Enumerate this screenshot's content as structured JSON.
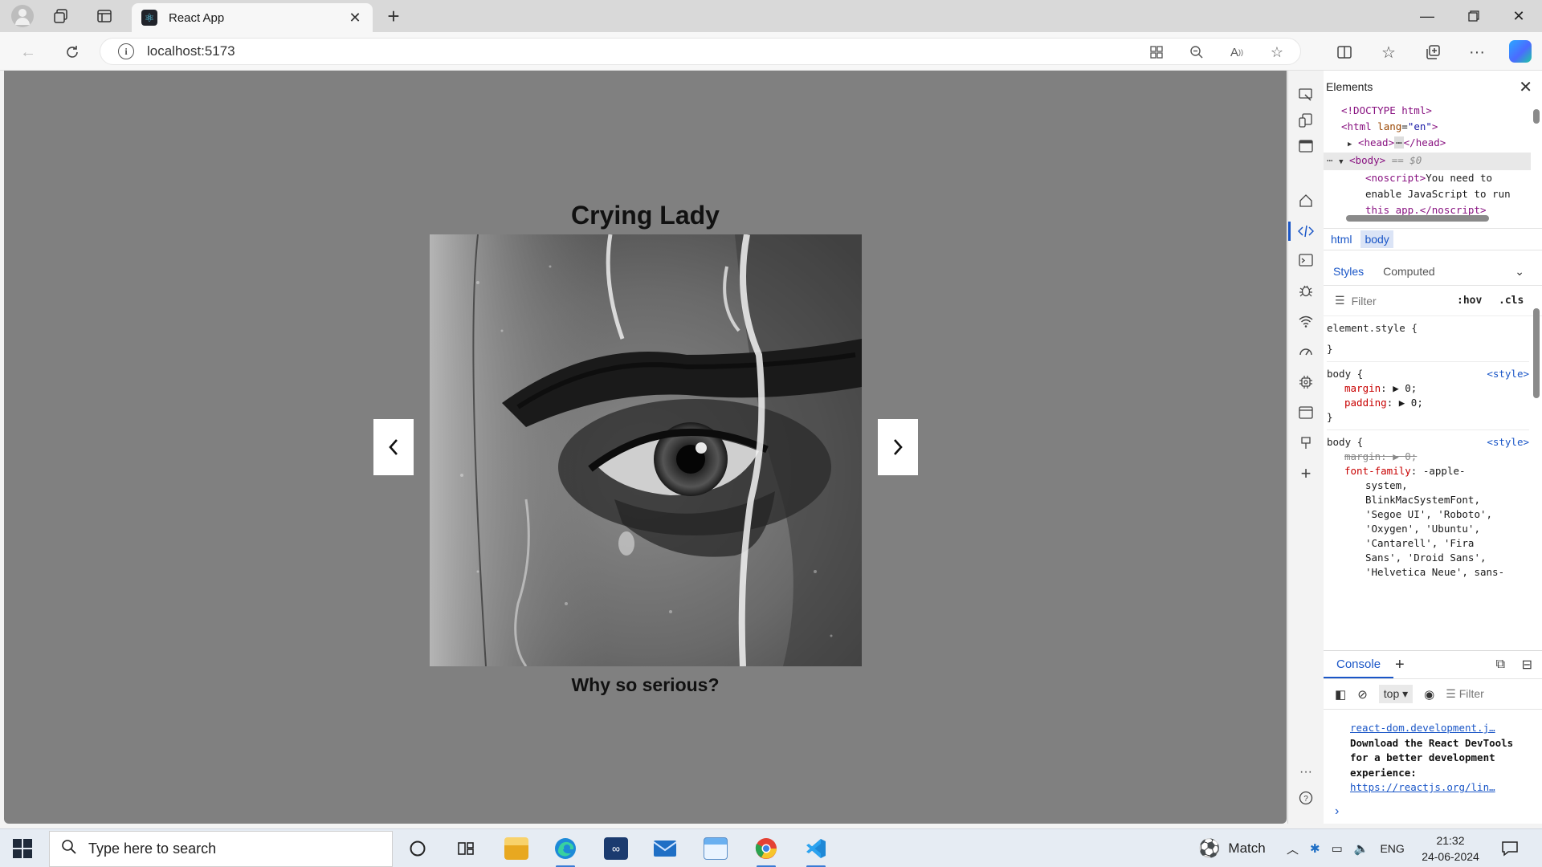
{
  "browser": {
    "tab_title": "React App",
    "url": "localhost:5173"
  },
  "page": {
    "title": "Crying Lady",
    "caption": "Why so serious?",
    "prev_label": "‹",
    "next_label": "›"
  },
  "devtools": {
    "panel_title": "Elements",
    "dom": {
      "doctype": "<!DOCTYPE html>",
      "html_open": "<html",
      "html_attr_name": "lang",
      "html_attr_value": "\"en\"",
      "head": "<head>",
      "head_close": "</head>",
      "body": "<body>",
      "body_marker": "== $0",
      "noscript_open": "<noscript>",
      "noscript_text_1": "You need to",
      "noscript_text_2": "enable JavaScript to run",
      "noscript_text_3": "this app.</noscript>"
    },
    "breadcrumbs": [
      "html",
      "body"
    ],
    "subtabs": {
      "styles": "Styles",
      "computed": "Computed"
    },
    "filter_placeholder": "Filter",
    "hov": ":hov",
    "cls": ".cls",
    "styles": {
      "element_style": "element.style {",
      "close_brace": "}",
      "body_selector": "body {",
      "source": "<style>",
      "margin_name": "margin",
      "margin_value": "▶ 0;",
      "padding_name": "padding",
      "padding_value": "▶ 0;",
      "ff_name": "font-family",
      "ff_lines": [
        "-apple-",
        "system,",
        "BlinkMacSystemFont,",
        "'Segoe UI', 'Roboto',",
        "'Oxygen', 'Ubuntu',",
        "'Cantarell', 'Fira",
        "Sans', 'Droid Sans',",
        "'Helvetica Neue', sans-"
      ]
    },
    "console": {
      "tab": "Console",
      "context": "top",
      "filter": "Filter",
      "source_link": "react-dom.development.j…",
      "message": "Download the React DevTools for a better development experience:",
      "link": "https://reactjs.org/lin…"
    }
  },
  "taskbar": {
    "search_placeholder": "Type here to search",
    "weather_label": "Match",
    "language": "ENG",
    "time": "21:32",
    "date": "24-06-2024"
  }
}
